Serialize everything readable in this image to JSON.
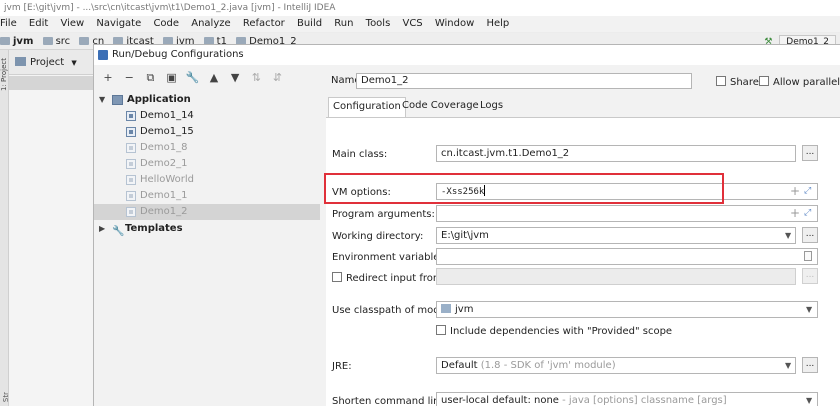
{
  "window": {
    "title": "jvm [E:\\git\\jvm] - ...\\src\\cn\\itcast\\jvm\\t1\\Demo1_2.java [jvm] - IntelliJ IDEA"
  },
  "menu": [
    "File",
    "Edit",
    "View",
    "Navigate",
    "Code",
    "Analyze",
    "Refactor",
    "Build",
    "Run",
    "Tools",
    "VCS",
    "Window",
    "Help"
  ],
  "nav": {
    "crumbs": [
      "jvm",
      "src",
      "cn",
      "itcast",
      "jvm",
      "t1",
      "Demo1_2"
    ],
    "run_config": "Demo1_2"
  },
  "project_panel": {
    "label": "Project"
  },
  "dialog": {
    "title": "Run/Debug Configurations",
    "toolbar": [
      "+",
      "−",
      "⧉",
      "▣",
      "🔧",
      "▲",
      "▼",
      "⇅",
      "⇵"
    ],
    "tree": {
      "application": "Application",
      "items": [
        "Demo1_14",
        "Demo1_15",
        "Demo1_8",
        "Demo2_1",
        "HelloWorld",
        "Demo1_1",
        "Demo1_2"
      ],
      "templates": "Templates"
    },
    "name_label": "Name:",
    "name_value": "Demo1_2",
    "share_label": "Share",
    "parallel_label": "Allow parallel run",
    "tabs": [
      "Configuration",
      "Code Coverage",
      "Logs"
    ],
    "form": {
      "main_class_label": "Main class:",
      "main_class_value": "cn.itcast.jvm.t1.Demo1_2",
      "vm_options_label": "VM options:",
      "vm_options_value": "-Xss256k",
      "program_args_label": "Program arguments:",
      "working_dir_label": "Working directory:",
      "working_dir_value": "E:\\git\\jvm",
      "env_vars_label": "Environment variables:",
      "redirect_label": "Redirect input from:",
      "classpath_label": "Use classpath of module:",
      "classpath_value": "jvm",
      "include_deps_label": "Include dependencies with \"Provided\" scope",
      "jre_label": "JRE:",
      "jre_value": "Default",
      "jre_hint": "(1.8 - SDK of 'jvm' module)",
      "shorten_label": "Shorten command line:",
      "shorten_value": "user-local default: none",
      "shorten_hint": "- java [options] classname [args]"
    }
  },
  "colors": {
    "highlight_box": "#e0303a"
  }
}
